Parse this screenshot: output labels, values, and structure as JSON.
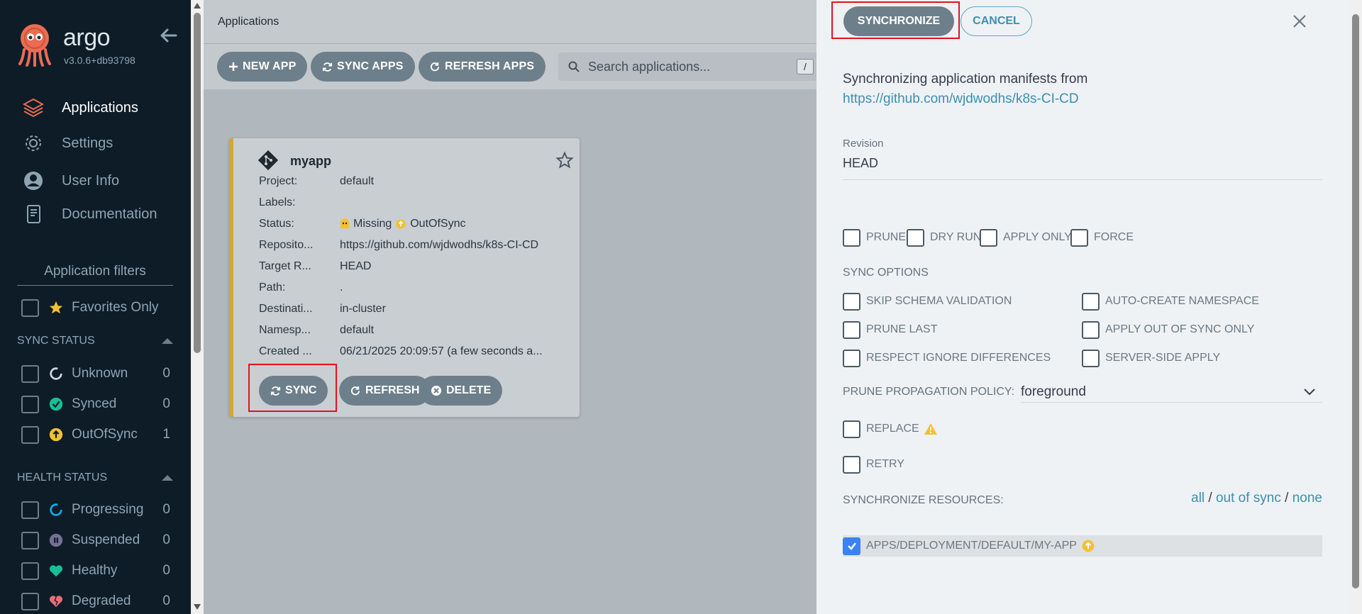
{
  "sidebar": {
    "brand": "argo",
    "version": "v3.0.6+db93798",
    "nav": [
      {
        "label": "Applications",
        "icon": "stack-layers-icon",
        "active": true
      },
      {
        "label": "Settings",
        "icon": "gear-icon"
      },
      {
        "label": "User Info",
        "icon": "user-icon"
      },
      {
        "label": "Documentation",
        "icon": "book-icon"
      }
    ],
    "filters_title": "Application filters",
    "favorites_label": "Favorites Only",
    "sync_status_title": "SYNC STATUS",
    "sync_status": [
      {
        "label": "Unknown",
        "count": "0"
      },
      {
        "label": "Synced",
        "count": "0"
      },
      {
        "label": "OutOfSync",
        "count": "1"
      }
    ],
    "health_status_title": "HEALTH STATUS",
    "health_status": [
      {
        "label": "Progressing",
        "count": "0"
      },
      {
        "label": "Suspended",
        "count": "0"
      },
      {
        "label": "Healthy",
        "count": "0"
      },
      {
        "label": "Degraded",
        "count": "0"
      }
    ]
  },
  "main": {
    "title": "Applications",
    "toolbar": {
      "new_app": "NEW APP",
      "sync_apps": "SYNC APPS",
      "refresh_apps": "REFRESH APPS",
      "search_placeholder": "Search applications...",
      "search_shortcut": "/"
    },
    "card": {
      "name": "myapp",
      "rows": [
        {
          "key": "Project:",
          "value": "default"
        },
        {
          "key": "Labels:",
          "value": ""
        },
        {
          "key": "Status:",
          "value": "Missing",
          "value2": "OutOfSync"
        },
        {
          "key": "Reposito...",
          "value": "https://github.com/wjdwodhs/k8s-CI-CD"
        },
        {
          "key": "Target R...",
          "value": "HEAD"
        },
        {
          "key": "Path:",
          "value": "."
        },
        {
          "key": "Destinati...",
          "value": "in-cluster"
        },
        {
          "key": "Namesp...",
          "value": "default"
        },
        {
          "key": "Created ...",
          "value": "06/21/2025 20:09:57  (a few seconds a..."
        }
      ],
      "sync": "SYNC",
      "refresh": "REFRESH",
      "delete": "DELETE"
    }
  },
  "panel": {
    "synchronize": "SYNCHRONIZE",
    "cancel": "CANCEL",
    "intro": "Synchronizing application manifests from",
    "repo_url": "https://github.com/wjdwodhs/k8s-CI-CD",
    "revision_label": "Revision",
    "revision_value": "HEAD",
    "top_options": [
      "PRUNE",
      "DRY RUN",
      "APPLY ONLY",
      "FORCE"
    ],
    "sync_options_title": "SYNC OPTIONS",
    "sync_options_left": [
      "SKIP SCHEMA VALIDATION",
      "PRUNE LAST",
      "RESPECT IGNORE DIFFERENCES"
    ],
    "sync_options_right": [
      "AUTO-CREATE NAMESPACE",
      "APPLY OUT OF SYNC ONLY",
      "SERVER-SIDE APPLY"
    ],
    "prune_policy_label": "PRUNE PROPAGATION POLICY:",
    "prune_policy_value": "foreground",
    "replace_label": "REPLACE",
    "retry_label": "RETRY",
    "sync_resources_label": "SYNCHRONIZE RESOURCES:",
    "sel_all": "all",
    "sel_out_of_sync": "out of sync",
    "sel_none": "none",
    "resource": "APPS/DEPLOYMENT/DEFAULT/MY-APP"
  },
  "colors": {
    "sidebar_bg": "#0e1c28",
    "button": "#6d7f8b",
    "link": "#3e8eb0",
    "out_of_sync": "#f4c030",
    "synced": "#18be94",
    "highlight": "#e0131d"
  }
}
